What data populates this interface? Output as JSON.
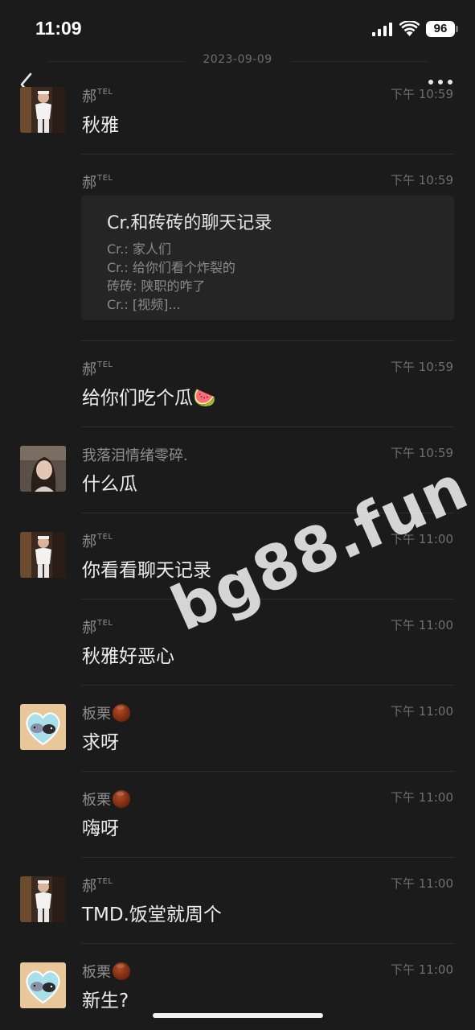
{
  "status_bar": {
    "time": "11:09",
    "battery": "96"
  },
  "date_separator": "2023-09-09",
  "watermark": "bg88.fun",
  "messages": [
    {
      "sender": "郝",
      "tag": "TEL",
      "time": "下午 10:59",
      "text": "秋雅"
    },
    {
      "sender": "郝",
      "tag": "TEL",
      "time": "下午 10:59",
      "record": {
        "title": "Cr.和砖砖的聊天记录",
        "lines": [
          "Cr.: 家人们",
          "Cr.: 给你们看个炸裂的",
          "砖砖: 陕职的咋了",
          "Cr.: [视频]..."
        ]
      }
    },
    {
      "sender": "郝",
      "tag": "TEL",
      "time": "下午 10:59",
      "text": "给你们吃个瓜🍉"
    },
    {
      "sender": "我落泪情绪零碎.",
      "time": "下午 10:59",
      "text": "什么瓜"
    },
    {
      "sender": "郝",
      "tag": "TEL",
      "time": "下午 11:00",
      "text": "你看看聊天记录"
    },
    {
      "sender": "郝",
      "tag": "TEL",
      "time": "下午 11:00",
      "text": "秋雅好恶心"
    },
    {
      "sender": "板栗",
      "time": "下午 11:00",
      "text": "求呀"
    },
    {
      "sender": "板栗",
      "time": "下午 11:00",
      "text": "嗨呀"
    },
    {
      "sender": "郝",
      "tag": "TEL",
      "time": "下午 11:00",
      "text": "TMD.饭堂就周个"
    },
    {
      "sender": "板栗",
      "time": "下午 11:00",
      "text": "新生?"
    }
  ]
}
